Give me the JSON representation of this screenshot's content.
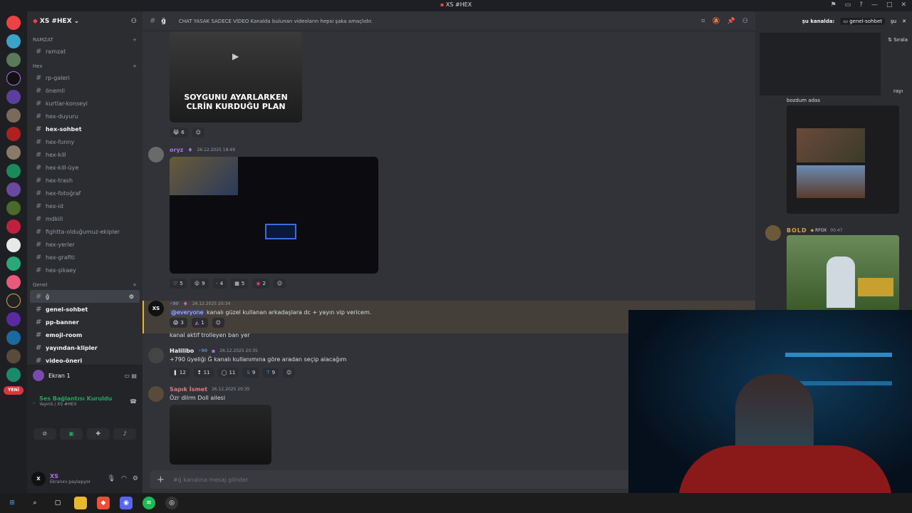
{
  "window": {
    "title": "XS #HEX"
  },
  "server": {
    "name": "XS #HEX",
    "logo": "XS"
  },
  "categories": {
    "ramzat": "RAMZAT",
    "hex": "Hex",
    "genel": "Genel"
  },
  "channels_ramzat": [
    {
      "label": "ramzat"
    }
  ],
  "channels_hex": [
    {
      "label": "rp-galeri"
    },
    {
      "label": "önemli"
    },
    {
      "label": "kurtlar-konseyi"
    },
    {
      "label": "hex-duyuru"
    },
    {
      "label": "hex-sohbet"
    },
    {
      "label": "hex-funny"
    },
    {
      "label": "hex-kill"
    },
    {
      "label": "hex-kill-üye"
    },
    {
      "label": "hex-trash"
    },
    {
      "label": "hex-fotoğraf"
    },
    {
      "label": "hex-id"
    },
    {
      "label": "mdkill"
    },
    {
      "label": "fightta-olduğumuz-ekipler"
    },
    {
      "label": "hex-yerler"
    },
    {
      "label": "hex-grafiti"
    },
    {
      "label": "hex-şikaey"
    }
  ],
  "channels_genel": [
    {
      "label": "ğ"
    },
    {
      "label": "genel-sohbet"
    },
    {
      "label": "pp-banner"
    },
    {
      "label": "emoji-room"
    },
    {
      "label": "yayından-klipler"
    },
    {
      "label": "video-öneri"
    },
    {
      "label": "spotify"
    }
  ],
  "rail": {
    "new_badge": "YENİ"
  },
  "voice": {
    "stream_title": "Ekran 1",
    "connected": "Ses Bağlantısı Kuruldu",
    "channel": "YayınS / XS #HEX"
  },
  "user": {
    "name": "XS",
    "status": "Ekranını paylaşıyor"
  },
  "header": {
    "channel": "ğ",
    "topic": "CHAT YASAK SADECE VİDEO Kanalda bulunan videoların hepsi şaka amaçlıdır."
  },
  "messages": {
    "video1_caption": "SOYGUNU AYARLARKEN CLRİN KURDUĞU PLAN",
    "video1_react_count": "6",
    "oryz_name": "oryz",
    "oryz_time": "26.12.2025 18:49",
    "oryz_reacts": [
      "5",
      "9",
      "4",
      "5",
      "2"
    ],
    "xs_badge": "90",
    "xs_time": "26.12.2025 20:34",
    "xs_mention": "@everyone",
    "xs_text": "kanalı güzel kullanan arkadaşlara dc + yayın vip vericem.",
    "xs_reacts": [
      "3",
      "1"
    ],
    "xs_text2": "kanal aktif trolleyen ban yer",
    "halil_name": "Halilibo",
    "halil_badge": "90",
    "halil_time": "26.12.2025 20:35",
    "halil_text": "+790 üyeliği Ğ kanalı kullanımına göre aradan seçip alacağım",
    "halil_reacts": [
      "12",
      "11",
      "11",
      "9",
      "9"
    ],
    "sapik_name": "Sapık İsmet",
    "sapik_time": "26.12.2025 20:35",
    "sapik_text": "Özr dilrm Doll ailesi"
  },
  "input": {
    "placeholder": "#ğ kanalına mesaj gönder"
  },
  "side": {
    "search_label": "şu kanalda:",
    "search_chip": "genel-sohbet",
    "search_more": "şu",
    "sort": "Sırala",
    "result1_frag": "rayı",
    "result2_text": "bozdum adas",
    "bold_name": "BOLD",
    "bold_tag": "RFOX",
    "bold_time": "00:47"
  },
  "colors": {
    "accent_red": "#ed4245",
    "online_green": "#23a55a",
    "mention_bg": "#444039",
    "oryz_name": "#b06ee8",
    "sapik_name": "#e07b7b",
    "bold_name": "#d4a54a"
  }
}
